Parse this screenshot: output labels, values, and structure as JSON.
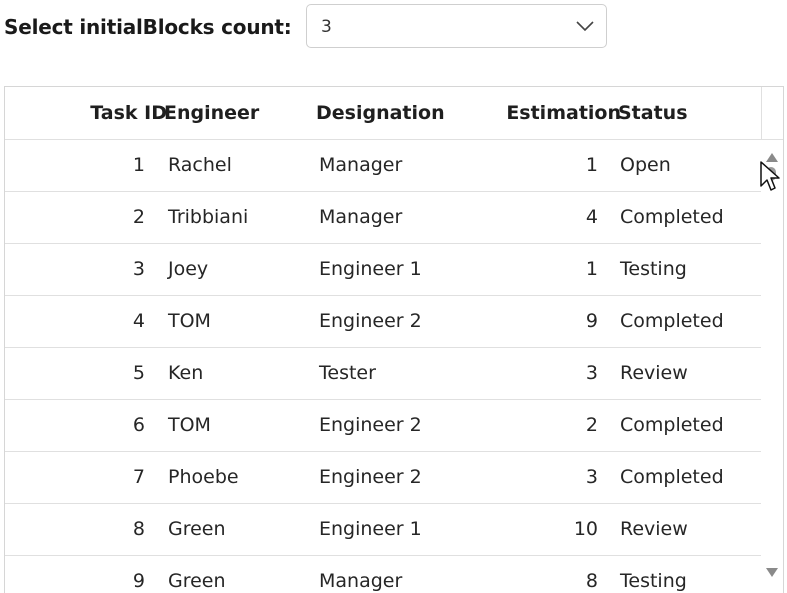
{
  "toolbar": {
    "label": "Select initialBlocks count:",
    "select_value": "3"
  },
  "grid": {
    "columns": [
      "Task ID",
      "Engineer",
      "Designation",
      "Estimation",
      "Status"
    ],
    "rows": [
      {
        "task_id": "1",
        "engineer": "Rachel",
        "designation": "Manager",
        "estimation": "1",
        "status": "Open"
      },
      {
        "task_id": "2",
        "engineer": "Tribbiani",
        "designation": "Manager",
        "estimation": "4",
        "status": "Completed"
      },
      {
        "task_id": "3",
        "engineer": "Joey",
        "designation": "Engineer 1",
        "estimation": "1",
        "status": "Testing"
      },
      {
        "task_id": "4",
        "engineer": "TOM",
        "designation": "Engineer 2",
        "estimation": "9",
        "status": "Completed"
      },
      {
        "task_id": "5",
        "engineer": "Ken",
        "designation": "Tester",
        "estimation": "3",
        "status": "Review"
      },
      {
        "task_id": "6",
        "engineer": "TOM",
        "designation": "Engineer 2",
        "estimation": "2",
        "status": "Completed"
      },
      {
        "task_id": "7",
        "engineer": "Phoebe",
        "designation": "Engineer 2",
        "estimation": "3",
        "status": "Completed"
      },
      {
        "task_id": "8",
        "engineer": "Green",
        "designation": "Engineer 1",
        "estimation": "10",
        "status": "Review"
      },
      {
        "task_id": "9",
        "engineer": "Green",
        "designation": "Manager",
        "estimation": "8",
        "status": "Testing"
      }
    ]
  },
  "icons": {
    "select_chevron": "chevron-down-icon",
    "scroll_up": "triangle-up-icon",
    "scroll_down": "triangle-down-icon",
    "cursor": "mouse-pointer-icon"
  }
}
